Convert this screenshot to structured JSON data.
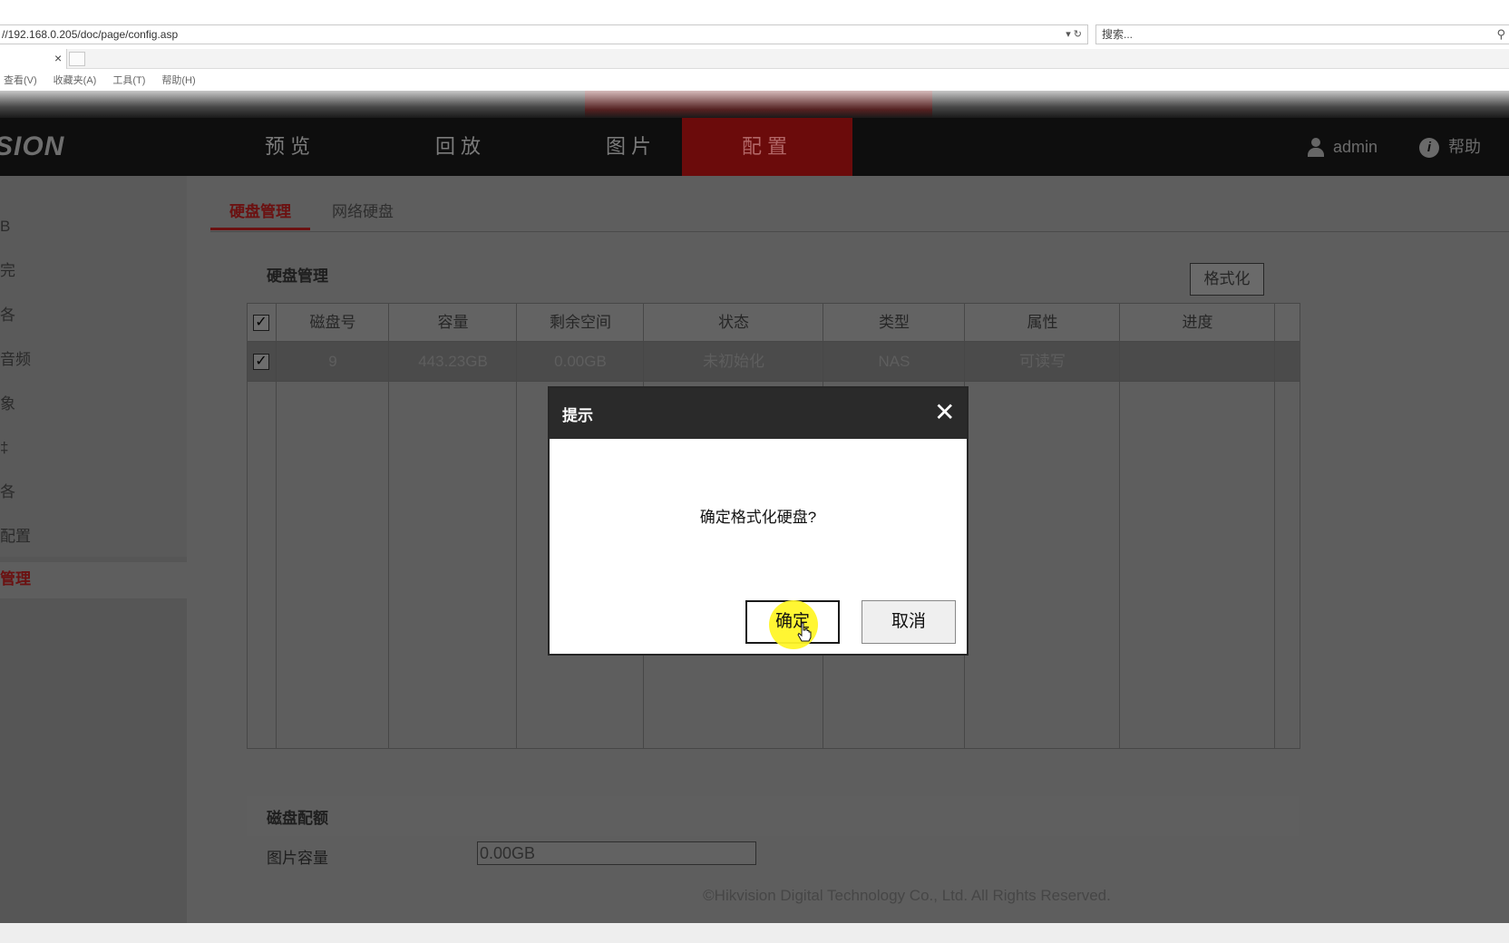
{
  "browser": {
    "address": "//192.168.0.205/doc/page/config.asp",
    "address_tools": "▾ ↻",
    "search_placeholder": "搜索...",
    "menu": [
      "查看(V)",
      "收藏夹(A)",
      "工具(T)",
      "帮助(H)"
    ]
  },
  "header": {
    "logo": "SION",
    "nav": [
      {
        "label": "预览"
      },
      {
        "label": "回放"
      },
      {
        "label": "图片"
      },
      {
        "label": "配置",
        "active": true
      }
    ],
    "user": "admin",
    "help": "帮助"
  },
  "sidebar": {
    "items": [
      {
        "label": "B"
      },
      {
        "label": "完"
      },
      {
        "label": "各"
      },
      {
        "label": "音频"
      },
      {
        "label": "象"
      },
      {
        "label": "‡"
      },
      {
        "label": "各"
      },
      {
        "label": "配置"
      },
      {
        "label": "管理",
        "active": true
      }
    ]
  },
  "subtabs": [
    {
      "label": "硬盘管理",
      "active": true
    },
    {
      "label": "网络硬盘"
    }
  ],
  "disk_panel": {
    "title": "硬盘管理",
    "format_label": "格式化",
    "columns": [
      "磁盘号",
      "容量",
      "剩余空间",
      "状态",
      "类型",
      "属性",
      "进度"
    ],
    "rows": [
      {
        "checked": true,
        "cells": [
          "9",
          "443.23GB",
          "0.00GB",
          "未初始化",
          "NAS",
          "可读写",
          ""
        ]
      }
    ],
    "header_checked": true,
    "check_glyph": "✓"
  },
  "quota_panel": {
    "title": "磁盘配额",
    "pic_capacity_label": "图片容量",
    "pic_capacity_value": "0.00GB"
  },
  "footer": "©Hikvision Digital Technology Co., Ltd. All Rights Reserved.",
  "dialog": {
    "title": "提示",
    "close_glyph": "✕",
    "message": "确定格式化硬盘?",
    "confirm_label": "确定",
    "cancel_label": "取消"
  },
  "icons": {
    "search": "search-icon",
    "close": "close-icon",
    "user": "user-icon",
    "help": "info-icon",
    "cursor": "hand-cursor-icon"
  },
  "colors": {
    "accent": "#c8141a",
    "header_bg": "#0e0e0e",
    "highlight": "#fff628"
  }
}
